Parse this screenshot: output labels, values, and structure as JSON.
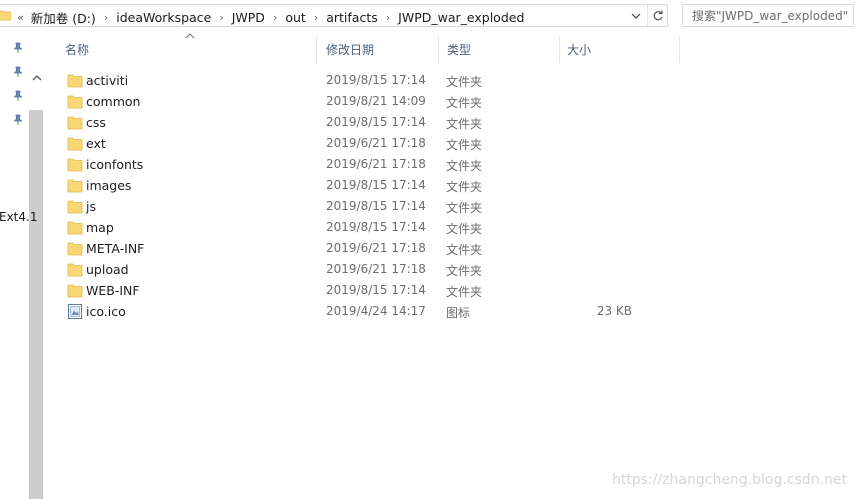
{
  "address_bar": {
    "leading_chevron": "«",
    "breadcrumbs": [
      "新加卷 (D:)",
      "ideaWorkspace",
      "JWPD",
      "out",
      "artifacts",
      "JWPD_war_exploded"
    ],
    "separator": "›"
  },
  "search": {
    "placeholder": "搜索\"JWPD_war_exploded\""
  },
  "nav_pane": {
    "partial_label": "Ext4.1"
  },
  "columns": {
    "name": "名称",
    "date": "修改日期",
    "type": "类型",
    "size": "大小"
  },
  "files": [
    {
      "name": "activiti",
      "date": "2019/8/15 17:14",
      "type": "文件夹",
      "size": "",
      "icon": "folder-icon"
    },
    {
      "name": "common",
      "date": "2019/8/21 14:09",
      "type": "文件夹",
      "size": "",
      "icon": "folder-icon"
    },
    {
      "name": "css",
      "date": "2019/8/15 17:14",
      "type": "文件夹",
      "size": "",
      "icon": "folder-icon"
    },
    {
      "name": "ext",
      "date": "2019/6/21 17:18",
      "type": "文件夹",
      "size": "",
      "icon": "folder-icon"
    },
    {
      "name": "iconfonts",
      "date": "2019/6/21 17:18",
      "type": "文件夹",
      "size": "",
      "icon": "folder-icon"
    },
    {
      "name": "images",
      "date": "2019/8/15 17:14",
      "type": "文件夹",
      "size": "",
      "icon": "folder-icon"
    },
    {
      "name": "js",
      "date": "2019/8/15 17:14",
      "type": "文件夹",
      "size": "",
      "icon": "folder-icon"
    },
    {
      "name": "map",
      "date": "2019/8/15 17:14",
      "type": "文件夹",
      "size": "",
      "icon": "folder-icon"
    },
    {
      "name": "META-INF",
      "date": "2019/6/21 17:18",
      "type": "文件夹",
      "size": "",
      "icon": "folder-icon"
    },
    {
      "name": "upload",
      "date": "2019/6/21 17:18",
      "type": "文件夹",
      "size": "",
      "icon": "folder-icon"
    },
    {
      "name": "WEB-INF",
      "date": "2019/8/15 17:14",
      "type": "文件夹",
      "size": "",
      "icon": "folder-icon"
    },
    {
      "name": "ico.ico",
      "date": "2019/4/24 14:17",
      "type": "图标",
      "size": "23 KB",
      "icon": "ico-file-icon"
    }
  ],
  "watermark": "https://zhangcheng.blog.csdn.net",
  "colors": {
    "folder": "#f8d775",
    "folder_dark": "#e5b846",
    "header_text": "#4c607a",
    "pin": "#6b8fb3"
  }
}
